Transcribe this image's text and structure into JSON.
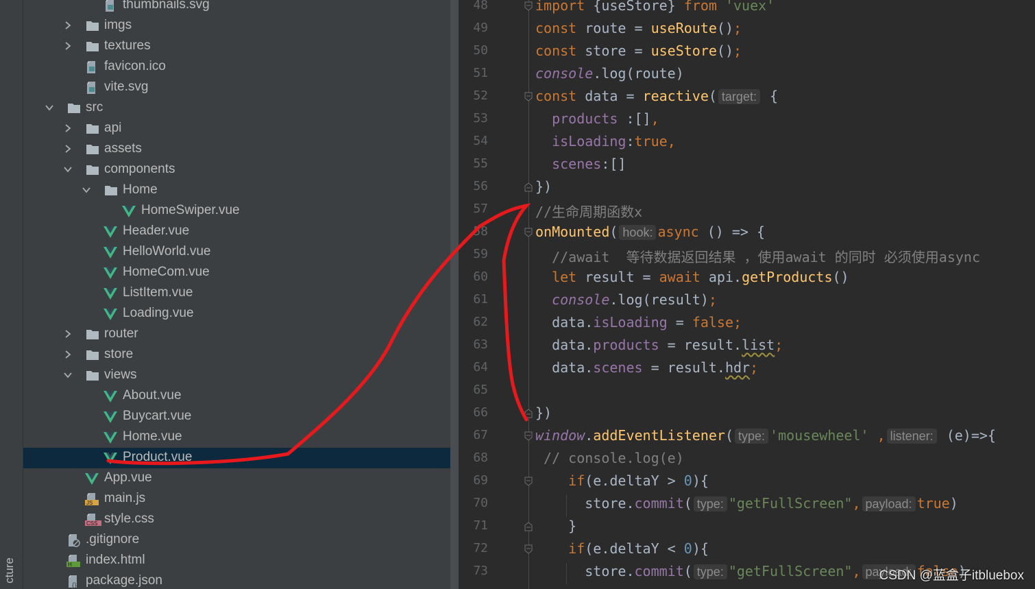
{
  "side_strip": {
    "label": "cture"
  },
  "project_tree": {
    "selected": "Product.vue",
    "items": [
      {
        "name": "thumbnails.svg",
        "depth": 3,
        "kind": "svg",
        "expanded": null
      },
      {
        "name": "imgs",
        "depth": 2,
        "kind": "folder",
        "expanded": false
      },
      {
        "name": "textures",
        "depth": 2,
        "kind": "folder",
        "expanded": false
      },
      {
        "name": "favicon.ico",
        "depth": 2,
        "kind": "ico",
        "expanded": null
      },
      {
        "name": "vite.svg",
        "depth": 2,
        "kind": "svg",
        "expanded": null
      },
      {
        "name": "src",
        "depth": 1,
        "kind": "folder",
        "expanded": true
      },
      {
        "name": "api",
        "depth": 2,
        "kind": "folder",
        "expanded": false
      },
      {
        "name": "assets",
        "depth": 2,
        "kind": "folder",
        "expanded": false
      },
      {
        "name": "components",
        "depth": 2,
        "kind": "folder",
        "expanded": true
      },
      {
        "name": "Home",
        "depth": 3,
        "kind": "folder",
        "expanded": true
      },
      {
        "name": "HomeSwiper.vue",
        "depth": 4,
        "kind": "vue",
        "expanded": null
      },
      {
        "name": "Header.vue",
        "depth": 3,
        "kind": "vue",
        "expanded": null
      },
      {
        "name": "HelloWorld.vue",
        "depth": 3,
        "kind": "vue",
        "expanded": null
      },
      {
        "name": "HomeCom.vue",
        "depth": 3,
        "kind": "vue",
        "expanded": null
      },
      {
        "name": "ListItem.vue",
        "depth": 3,
        "kind": "vue",
        "expanded": null
      },
      {
        "name": "Loading.vue",
        "depth": 3,
        "kind": "vue",
        "expanded": null
      },
      {
        "name": "router",
        "depth": 2,
        "kind": "folder",
        "expanded": false
      },
      {
        "name": "store",
        "depth": 2,
        "kind": "folder",
        "expanded": false
      },
      {
        "name": "views",
        "depth": 2,
        "kind": "folder",
        "expanded": true
      },
      {
        "name": "About.vue",
        "depth": 3,
        "kind": "vue",
        "expanded": null
      },
      {
        "name": "Buycart.vue",
        "depth": 3,
        "kind": "vue",
        "expanded": null
      },
      {
        "name": "Home.vue",
        "depth": 3,
        "kind": "vue",
        "expanded": null
      },
      {
        "name": "Product.vue",
        "depth": 3,
        "kind": "vue",
        "expanded": null
      },
      {
        "name": "App.vue",
        "depth": 2,
        "kind": "vue",
        "expanded": null
      },
      {
        "name": "main.js",
        "depth": 2,
        "kind": "js",
        "expanded": null
      },
      {
        "name": "style.css",
        "depth": 2,
        "kind": "css",
        "expanded": null
      },
      {
        "name": ".gitignore",
        "depth": 1,
        "kind": "git",
        "expanded": null
      },
      {
        "name": "index.html",
        "depth": 1,
        "kind": "html",
        "expanded": null
      },
      {
        "name": "package.json",
        "depth": 1,
        "kind": "json",
        "expanded": null
      }
    ]
  },
  "editor": {
    "colors": {
      "keyword": "#cc7832",
      "function": "#ffc66d",
      "string": "#6a8759",
      "comment": "#808080",
      "number": "#6897bb",
      "property": "#9876aa",
      "text": "#a9b7c6"
    },
    "lines": [
      {
        "n": "48",
        "fold": "start",
        "t": [
          [
            "import ",
            "kw"
          ],
          [
            "{useStore} ",
            ""
          ],
          [
            "from ",
            "kw"
          ],
          [
            "'vuex'",
            "str"
          ]
        ]
      },
      {
        "n": "49",
        "t": [
          [
            "const ",
            "kw"
          ],
          [
            "route = ",
            ""
          ],
          [
            "useRoute",
            "fn"
          ],
          [
            "()",
            ""
          ],
          [
            ";",
            "kw"
          ]
        ]
      },
      {
        "n": "50",
        "t": [
          [
            "const ",
            "kw"
          ],
          [
            "store = ",
            ""
          ],
          [
            "useStore",
            "fn"
          ],
          [
            "()",
            ""
          ],
          [
            ";",
            "kw"
          ]
        ]
      },
      {
        "n": "51",
        "t": [
          [
            "console",
            "pi"
          ],
          [
            ".log(route)",
            ""
          ]
        ]
      },
      {
        "n": "52",
        "fold": "start",
        "t": [
          [
            "const ",
            "kw"
          ],
          [
            "data = ",
            ""
          ],
          [
            "reactive",
            "fn"
          ],
          [
            "(",
            ""
          ],
          [
            "target:",
            "hint"
          ],
          [
            " {",
            ""
          ]
        ]
      },
      {
        "n": "53",
        "t": [
          [
            "  ",
            ""
          ],
          [
            "products",
            "prop"
          ],
          [
            " :[]",
            ""
          ],
          [
            ",",
            "kw"
          ]
        ]
      },
      {
        "n": "54",
        "t": [
          [
            "  ",
            ""
          ],
          [
            "isLoading",
            "prop"
          ],
          [
            ":",
            ""
          ],
          [
            "true",
            "kw"
          ],
          [
            ",",
            "kw"
          ]
        ]
      },
      {
        "n": "55",
        "t": [
          [
            "  ",
            ""
          ],
          [
            "scenes",
            "prop"
          ],
          [
            ":[]",
            ""
          ]
        ]
      },
      {
        "n": "56",
        "fold": "end",
        "t": [
          [
            "})",
            ""
          ]
        ]
      },
      {
        "n": "57",
        "t": [
          [
            "//生命周期函数x",
            "cm"
          ]
        ]
      },
      {
        "n": "58",
        "fold": "start",
        "t": [
          [
            "onMounted",
            "fn"
          ],
          [
            "(",
            ""
          ],
          [
            "hook:",
            "hint"
          ],
          [
            "async",
            "kw"
          ],
          [
            " () => {",
            ""
          ]
        ]
      },
      {
        "n": "59",
        "t": [
          [
            "  ",
            ""
          ],
          [
            "//await  等待数据返回结果 ，使用await 的同时 必须使用async",
            "cm"
          ]
        ]
      },
      {
        "n": "60",
        "t": [
          [
            "  ",
            ""
          ],
          [
            "let ",
            "kw"
          ],
          [
            "result = ",
            ""
          ],
          [
            "await ",
            "kw"
          ],
          [
            "api.",
            ""
          ],
          [
            "getProducts",
            "fn"
          ],
          [
            "()",
            ""
          ]
        ]
      },
      {
        "n": "61",
        "t": [
          [
            "  ",
            ""
          ],
          [
            "console",
            "pi"
          ],
          [
            ".log(result)",
            ""
          ],
          [
            ";",
            "kw"
          ]
        ]
      },
      {
        "n": "62",
        "t": [
          [
            "  data.",
            ""
          ],
          [
            "isLoading",
            "prop"
          ],
          [
            " = ",
            ""
          ],
          [
            "false",
            "kw"
          ],
          [
            ";",
            "kw"
          ]
        ]
      },
      {
        "n": "63",
        "t": [
          [
            "  data.",
            ""
          ],
          [
            "products",
            "prop"
          ],
          [
            " = result.",
            ""
          ],
          [
            "list",
            "wavy"
          ],
          [
            ";",
            "kw"
          ]
        ]
      },
      {
        "n": "64",
        "t": [
          [
            "  data.",
            ""
          ],
          [
            "scenes",
            "prop"
          ],
          [
            " = result.",
            ""
          ],
          [
            "hdr",
            "wavy"
          ],
          [
            ";",
            "kw"
          ]
        ]
      },
      {
        "n": "65",
        "t": []
      },
      {
        "n": "66",
        "fold": "end",
        "t": [
          [
            "})",
            ""
          ]
        ]
      },
      {
        "n": "67",
        "fold": "start",
        "t": [
          [
            "window",
            "pi"
          ],
          [
            ".",
            ""
          ],
          [
            "addEventListener",
            "fn"
          ],
          [
            "(",
            ""
          ],
          [
            "type:",
            "hint"
          ],
          [
            "'mousewheel'",
            "str"
          ],
          [
            " ",
            ""
          ],
          [
            ",",
            "kw"
          ],
          [
            "listener:",
            "hint"
          ],
          [
            " (e)=>{",
            ""
          ]
        ]
      },
      {
        "n": "68",
        "t": [
          [
            " ",
            ""
          ],
          [
            "// console.log(e)",
            "cm"
          ]
        ]
      },
      {
        "n": "69",
        "fold": "start",
        "t": [
          [
            "    ",
            ""
          ],
          [
            "if",
            "kw"
          ],
          [
            "(e.deltaY > ",
            ""
          ],
          [
            "0",
            "num"
          ],
          [
            "){",
            ""
          ]
        ]
      },
      {
        "n": "70",
        "t": [
          [
            "      store.",
            ""
          ],
          [
            "commit",
            "prop"
          ],
          [
            "(",
            ""
          ],
          [
            "type:",
            "hint"
          ],
          [
            "\"getFullScreen\"",
            "str"
          ],
          [
            ",",
            "kw"
          ],
          [
            "payload:",
            "hint"
          ],
          [
            "true",
            "kw"
          ],
          [
            ")",
            ""
          ]
        ]
      },
      {
        "n": "71",
        "fold": "end",
        "t": [
          [
            "    }",
            ""
          ]
        ]
      },
      {
        "n": "72",
        "fold": "start",
        "t": [
          [
            "    ",
            ""
          ],
          [
            "if",
            "kw"
          ],
          [
            "(e.deltaY < ",
            ""
          ],
          [
            "0",
            "num"
          ],
          [
            "){",
            ""
          ]
        ]
      },
      {
        "n": "73",
        "t": [
          [
            "      store.",
            ""
          ],
          [
            "commit",
            "prop"
          ],
          [
            "(",
            ""
          ],
          [
            "type:",
            "hint"
          ],
          [
            "\"getFullScreen\"",
            "str"
          ],
          [
            ",",
            "kw"
          ],
          [
            "payload:",
            "hint"
          ],
          [
            "false",
            "kw"
          ],
          [
            ")",
            ""
          ]
        ]
      }
    ]
  },
  "watermark": "CSDN @蓝盒子itbluebox",
  "annotation_color": "#e8191c"
}
